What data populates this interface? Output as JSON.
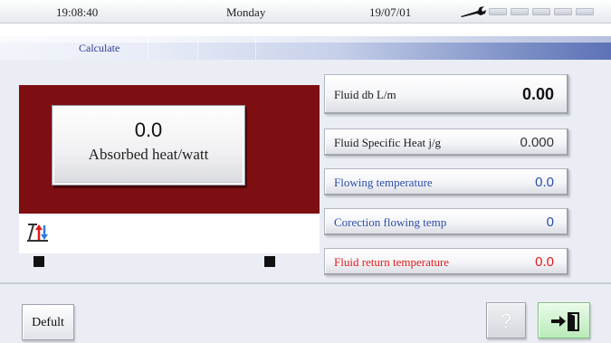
{
  "status_bar": {
    "time": "19:08:40",
    "day": "Monday",
    "date": "19/07/01"
  },
  "title_bar": {
    "label": "Calculate"
  },
  "absorbed_heat": {
    "value": "0.0",
    "label": "Absorbed heat/watt"
  },
  "fields": {
    "fluid_db": {
      "label": "Fluid db  L/m",
      "value": "0.00"
    },
    "fluid_specific_heat": {
      "label": "Fluid Specific Heat j/g",
      "value": "0.000"
    },
    "flowing_temperature": {
      "label": "Flowing temperature",
      "value": "0.0"
    },
    "correction_flowing_temp": {
      "label": "Corection flowing temp",
      "value": "0"
    },
    "fluid_return_temperature": {
      "label": "Fluid return temperature",
      "value": "0.0"
    }
  },
  "bottom_bar": {
    "default_label": "Defult",
    "help_label": "?"
  },
  "icons": {
    "status": "wrench-icon",
    "flow": "flow-direction-icon",
    "exit": "exit-door-icon"
  },
  "colors": {
    "panel_maroon": "#7d0f12",
    "blue_text": "#2c4ca8",
    "red_text": "#e11a1a",
    "exit_green": "#b9eab9"
  }
}
